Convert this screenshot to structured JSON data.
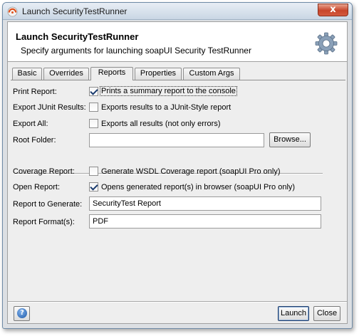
{
  "window": {
    "title": "Launch SecurityTestRunner",
    "close_glyph": "x"
  },
  "header": {
    "title": "Launch SecurityTestRunner",
    "description": "Specify arguments for launching soapUI Security TestRunner",
    "icon": "gear-icon"
  },
  "tabs": [
    {
      "label": "Basic",
      "active": false
    },
    {
      "label": "Overrides",
      "active": false
    },
    {
      "label": "Reports",
      "active": true
    },
    {
      "label": "Properties",
      "active": false
    },
    {
      "label": "Custom Args",
      "active": false
    }
  ],
  "form": {
    "print_report": {
      "label": "Print Report:",
      "text": "Prints a summary report to the console",
      "checked": true
    },
    "export_junit": {
      "label": "Export JUnit Results:",
      "text": "Exports results to a JUnit-Style report",
      "checked": false
    },
    "export_all": {
      "label": "Export All:",
      "text": "Exports all results (not only errors)",
      "checked": false
    },
    "root_folder": {
      "label": "Root Folder:",
      "value": "",
      "browse_label": "Browse..."
    },
    "coverage_report": {
      "label": "Coverage Report:",
      "text": "Generate WSDL Coverage report (soapUI Pro only)",
      "checked": false
    },
    "open_report": {
      "label": "Open Report:",
      "text": "Opens generated report(s) in browser (soapUI Pro only)",
      "checked": true
    },
    "report_to_generate": {
      "label": "Report to Generate:",
      "value": "SecurityTest Report"
    },
    "report_format": {
      "label": "Report Format(s):",
      "value": "PDF"
    }
  },
  "footer": {
    "help_glyph": "?",
    "launch_label": "Launch",
    "close_label": "Close"
  }
}
